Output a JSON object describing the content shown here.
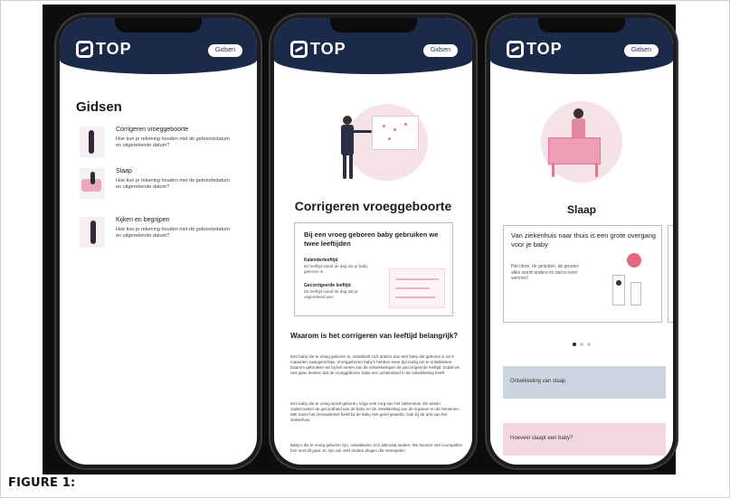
{
  "figure": {
    "caption": "FIGURE 1:"
  },
  "app": {
    "logo_text": "TOP",
    "guides_button": "Gidsen"
  },
  "screen1": {
    "title": "Gidsen",
    "guides": [
      {
        "title": "Corrigeren vroeggeboorte",
        "description": "Hoe kun je rekening houden met de geboortedatum en uitgerekende datum?"
      },
      {
        "title": "Slaap",
        "description": "Hoe kun je rekening houden met de geboortedatum en uitgerekende datum?"
      },
      {
        "title": "Kijken en begrijpen",
        "description": "Hoe kun je rekening houden met de geboortedatum en uitgerekende datum?"
      }
    ]
  },
  "screen2": {
    "heading": "Corrigeren vroeggeboorte",
    "card": {
      "title": "Bij een vroeg geboren baby gebruiken we twee leeftijden",
      "kalender_label": "Kalenderleeftijd",
      "kalender_text": "De leeftijd vanaf de dag dat je baby geboren is",
      "gecorrigeerde_label": "Gecorrigeerde leeftijd",
      "gecorrigeerde_text": "De leeftijd vanaf de dag dat je uitgerekend was"
    },
    "subheading": "Waarom is het corrigeren van leeftijd belangrijk?",
    "paragraphs": [
      "Een baby die te vroeg geboren is, ontwikkelt zich anders dan een baby die geboren is na 9 maanden zwangerschap. Vroeggeboren baby's hebben meer tijd nodig om te ontwikkelen. Daarom gebruiken we bij het meten van de ontwikkelingen de gecorrigeerde leeftijd. Zodat we niet gaan denken dat de vroeggeboren baby een achterstand in de ontwikkeling heeft.",
      "Een baby die te vroeg wordt geboren, krijgt veel zorg van het ziekenhuis. De artsen onderzoeken de gezondheid van de baby en de ontwikkeling van de organen en de hersenen. Met name het zenuwstelsel heeft bij de baby niet goed gewerkt. Ook bij de arts van het ziekenhuis.",
      "Baby's die te vroeg geboren zijn, ontwikkelen zich allemaal anders. We kunnen niet voorspellen hoe snel dit gaat. Er zijn ook veel andere dingen die meespelen."
    ]
  },
  "screen3": {
    "heading": "Slaap",
    "card": {
      "title": "Van ziekenhuis naar thuis is een grote overgang voor je baby",
      "text": "Het ritme, de geluiden, de geuren: alles wordt anders en dat is even wennen!"
    },
    "topics": [
      "Ontwikkeling van slaap",
      "Hoeveel slaapt een baby?"
    ]
  }
}
